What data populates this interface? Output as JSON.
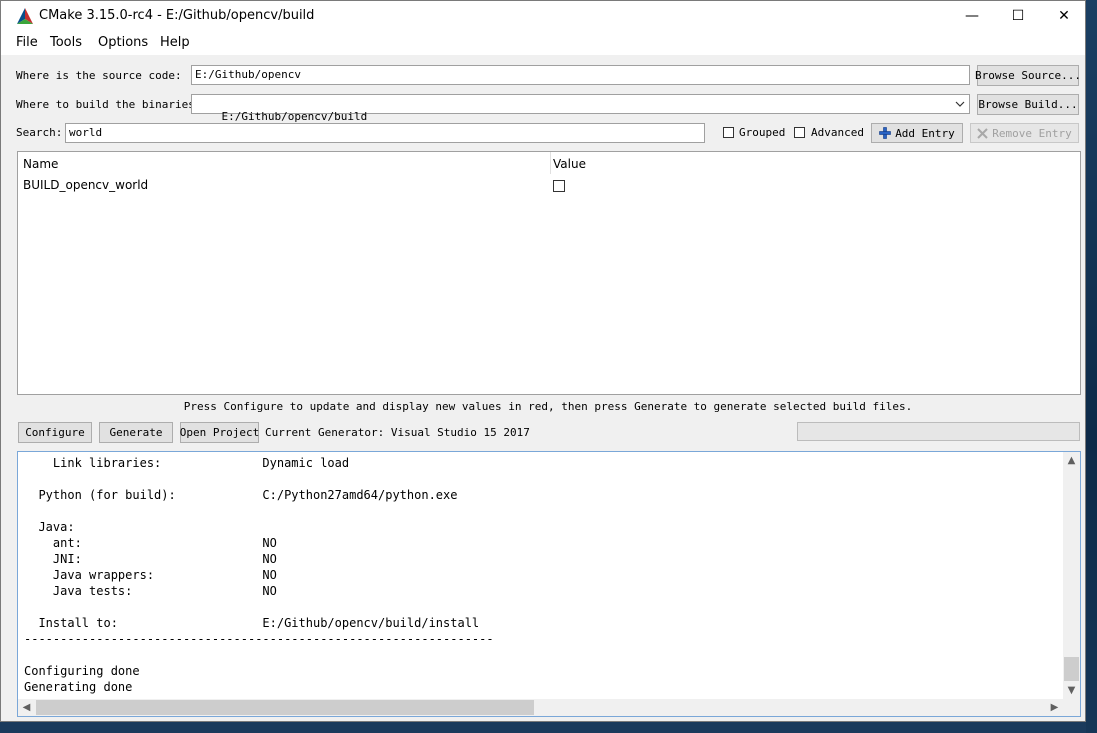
{
  "window": {
    "title": "CMake 3.15.0-rc4 - E:/Github/opencv/build",
    "controls": {
      "minimize": "—",
      "maximize": "☐",
      "close": "✕"
    }
  },
  "menu": {
    "items": [
      "File",
      "Tools",
      "Options",
      "Help"
    ]
  },
  "source": {
    "label": "Where is the source code:",
    "value": "E:/Github/opencv",
    "button": "Browse Source..."
  },
  "build": {
    "label": "Where to build the binaries:",
    "value": "E:/Github/opencv/build",
    "button": "Browse Build..."
  },
  "search": {
    "label": "Search:",
    "value": "world",
    "grouped_label": "Grouped",
    "advanced_label": "Advanced",
    "add_entry": "Add Entry",
    "remove_entry": "Remove Entry"
  },
  "table": {
    "columns": [
      "Name",
      "Value"
    ],
    "rows": [
      {
        "name": "BUILD_opencv_world",
        "checked": false
      }
    ]
  },
  "hint": "Press Configure to update and display new values in red, then press Generate to generate selected build files.",
  "actions": {
    "configure": "Configure",
    "generate": "Generate",
    "open_project": "Open Project",
    "current_generator": "Current Generator: Visual Studio 15 2017"
  },
  "output": {
    "lines": [
      "    Link libraries:              Dynamic load",
      "",
      "  Python (for build):            C:/Python27amd64/python.exe",
      "",
      "  Java:",
      "    ant:                         NO",
      "    JNI:                         NO",
      "    Java wrappers:               NO",
      "    Java tests:                  NO",
      "",
      "  Install to:                    E:/Github/opencv/build/install",
      "-----------------------------------------------------------------",
      "",
      "Configuring done",
      "Generating done"
    ]
  }
}
